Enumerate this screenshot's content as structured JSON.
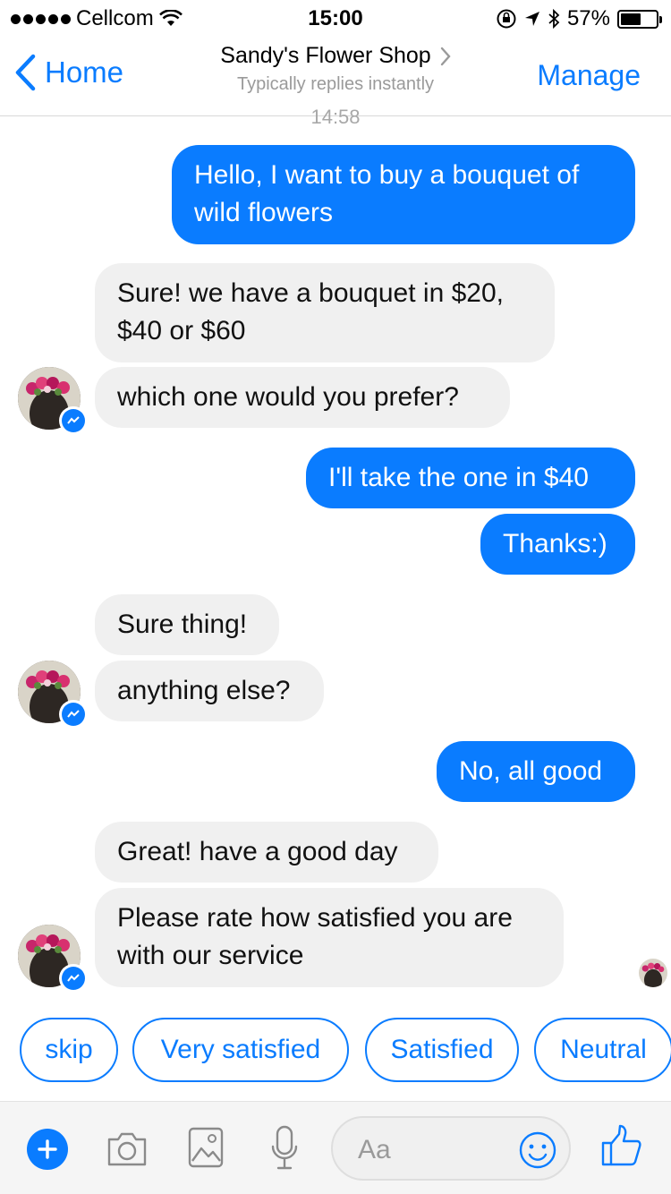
{
  "status_bar": {
    "carrier": "Cellcom",
    "time": "15:00",
    "battery_percent": "57%",
    "battery_level": 0.57
  },
  "nav": {
    "back_label": "Home",
    "title": "Sandy's Flower Shop",
    "subtitle": "Typically replies instantly",
    "manage_label": "Manage"
  },
  "timestamp": "14:58",
  "messages": [
    {
      "side": "out",
      "text": "Hello, I want to buy a bouquet of\nwild flowers"
    },
    {
      "side": "in",
      "text": "Sure! we have a bouquet in $20,\n$40 or $60"
    },
    {
      "side": "in",
      "text": "which one would you prefer?"
    },
    {
      "side": "out",
      "text": "I'll take the one in $40"
    },
    {
      "side": "out",
      "text": "Thanks:)"
    },
    {
      "side": "in",
      "text": "Sure thing!"
    },
    {
      "side": "in",
      "text": "anything else?"
    },
    {
      "side": "out",
      "text": "No, all good"
    },
    {
      "side": "in",
      "text": "Great! have a good day"
    },
    {
      "side": "in",
      "text": "Please rate how satisfied you are\nwith our service"
    }
  ],
  "quick_replies": [
    "skip",
    "Very satisfied",
    "Satisfied",
    "Neutral"
  ],
  "composer": {
    "placeholder": "Aa",
    "icons": [
      "plus-icon",
      "camera-icon",
      "image-icon",
      "microphone-icon",
      "emoji-icon",
      "thumbs-up-icon"
    ]
  },
  "colors": {
    "accent": "#0a7cff",
    "incoming_bubble": "#f0f0f0",
    "outgoing_text": "#ffffff"
  }
}
